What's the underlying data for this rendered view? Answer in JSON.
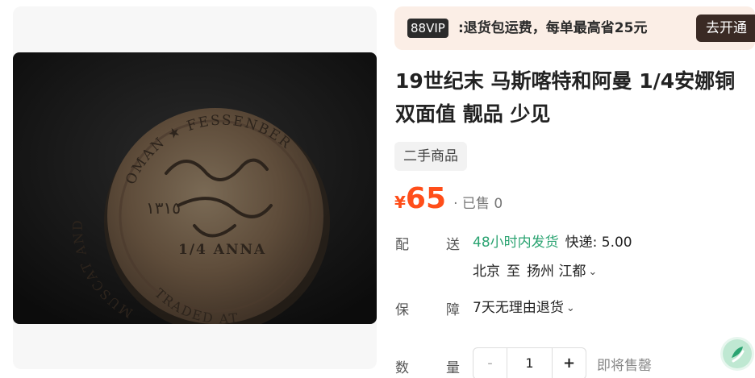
{
  "product": {
    "title_line1": "19世纪末 马斯喀特和阿曼 1/4安娜铜",
    "title_line2": "双面值 靓品 少见",
    "tag": "二手商品",
    "price_symbol": "¥",
    "price": "65",
    "sold": "· 已售 0"
  },
  "vip": {
    "badge": "88VIP",
    "text": ":退货包运费，每单最高省25元",
    "button": "去开通"
  },
  "coin_inscriptions": {
    "top": "OMAN ★ FESSENBER",
    "denomination": "1/4 ANNA",
    "left_edge": "MUSCAT AND",
    "bottom": "TRADED AT"
  },
  "delivery": {
    "label_a": "配",
    "label_b": "送",
    "speed": "48小时内发货",
    "fee": "快递: 5.00",
    "from": "北京",
    "to_word": "至",
    "dest": "扬州 江都"
  },
  "guarantee": {
    "label_a": "保",
    "label_b": "障",
    "text": "7天无理由退货"
  },
  "quantity": {
    "label_a": "数",
    "label_b": "量",
    "minus": "-",
    "value": "1",
    "plus": "+",
    "status": "即将售罄"
  },
  "icons": {
    "chevron": "chevron-down-icon",
    "logo": "app-logo-icon"
  },
  "colors": {
    "price": "#ff4e1a",
    "green": "#2aa371",
    "vip_bg": "#fbeee6"
  }
}
